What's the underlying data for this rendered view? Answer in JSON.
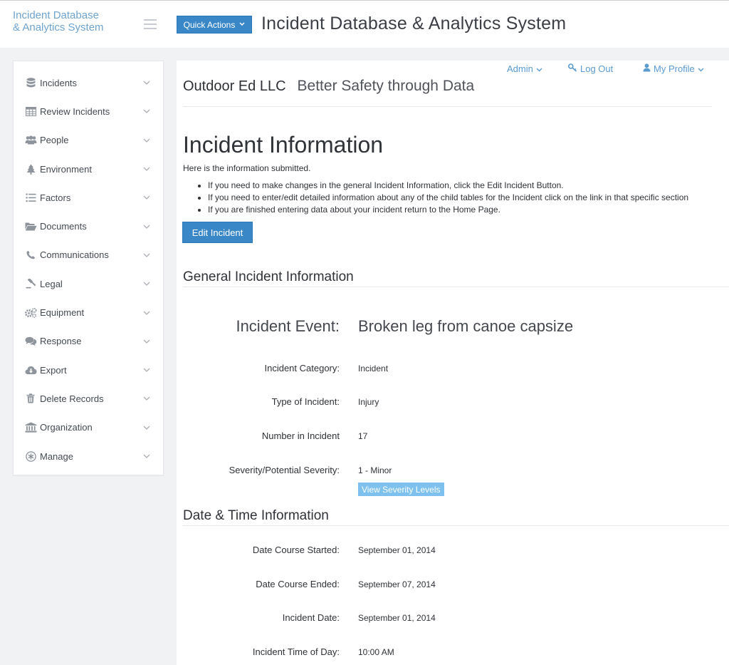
{
  "brand": {
    "line1": "Incident Database",
    "line2": "& Analytics System"
  },
  "topbar": {
    "quick_actions_label": "Quick Actions",
    "app_title": "Incident Database & Analytics System"
  },
  "sidebar": {
    "items": [
      {
        "label": "Incidents",
        "icon": "database-icon"
      },
      {
        "label": "Review Incidents",
        "icon": "table-icon"
      },
      {
        "label": "People",
        "icon": "users-icon"
      },
      {
        "label": "Environment",
        "icon": "tree-icon"
      },
      {
        "label": "Factors",
        "icon": "list-icon"
      },
      {
        "label": "Documents",
        "icon": "folder-open-icon"
      },
      {
        "label": "Communications",
        "icon": "phone-icon"
      },
      {
        "label": "Legal",
        "icon": "gavel-icon"
      },
      {
        "label": "Equipment",
        "icon": "gears-icon"
      },
      {
        "label": "Response",
        "icon": "comments-icon"
      },
      {
        "label": "Export",
        "icon": "cloud-download-icon"
      },
      {
        "label": "Delete Records",
        "icon": "trash-icon"
      },
      {
        "label": "Organization",
        "icon": "institution-icon"
      },
      {
        "label": "Manage",
        "icon": "asterisk-icon"
      }
    ]
  },
  "user_menu": {
    "admin_label": "Admin",
    "logout_label": "Log Out",
    "profile_label": "My Profile"
  },
  "org": {
    "name": "Outdoor Ed LLC",
    "tagline": "Better Safety through Data"
  },
  "page": {
    "title": "Incident Information",
    "intro": "Here is the information submitted.",
    "bullets": [
      "If you need to make changes in the general Incident Information, click the Edit Incident Button.",
      "If you need to enter/edit detailed information about any of the child tables for the Incident click on the link in that specific section",
      "If you are finished entering data about your incident return to the Home Page."
    ],
    "edit_button_label": "Edit Incident"
  },
  "general": {
    "heading": "General Incident Information",
    "event_label": "Incident Event:",
    "event_value": "Broken leg from canoe capsize",
    "category_label": "Incident Category:",
    "category_value": "Incident",
    "type_label": "Type of Incident:",
    "type_value": "Injury",
    "number_label": "Number in Incident",
    "number_value": "17",
    "severity_label": "Severity/Potential Severity:",
    "severity_value": "1 - Minor",
    "severity_link_label": "View Severity Levels"
  },
  "datetime": {
    "heading": "Date & Time Information",
    "course_started_label": "Date Course Started:",
    "course_started_value": "September 01, 2014",
    "course_ended_label": "Date Course Ended:",
    "course_ended_value": "September 07, 2014",
    "incident_date_label": "Incident Date:",
    "incident_date_value": "September 01, 2014",
    "time_of_day_label": "Incident Time of Day:",
    "time_of_day_value": "10:00 AM"
  }
}
